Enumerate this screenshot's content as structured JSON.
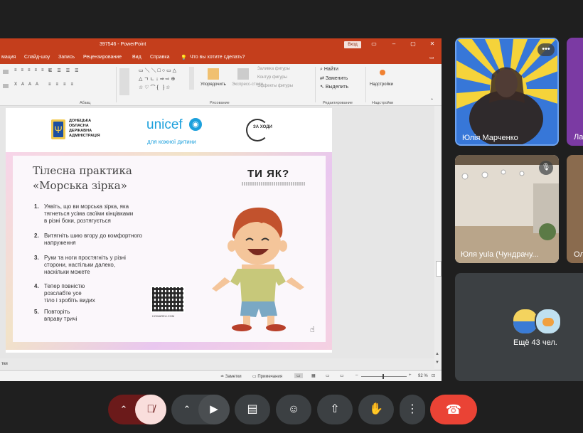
{
  "ppt": {
    "window_title": "397546  -  PowerPoint",
    "sign_in": "Вход",
    "menu": [
      "мация",
      "Слайд-шоу",
      "Запись",
      "Рецензирование",
      "Вид",
      "Справка",
      "Что вы хотите сделать?"
    ],
    "ribbon": {
      "paragraph": "Абзац",
      "drawing": "Рисование",
      "editing": "Редактирование",
      "addins": "Надстройки",
      "arrange": "Упорядочить",
      "quick_styles": "Экспресс-стили",
      "shape_fill": "Заливка фигуры",
      "shape_outline": "Контур фигуры",
      "shape_effects": "Эффекты фигуры",
      "find": "Найти",
      "replace": "Заменить",
      "select": "Выделить",
      "addins_btn": "Надстройки"
    },
    "notes_label": "тки",
    "status": {
      "notes": "Заметки",
      "comments": "Примечания",
      "zoom": "92 %"
    }
  },
  "slide": {
    "org_left": [
      "ДОНЕЦЬКА",
      "ОБЛАСНА",
      "ДЕРЖАВНА",
      "АДМІНІСТРАЦІЯ"
    ],
    "unicef": "unicef",
    "unicef_sub": "для кожної дитини",
    "right_logo": "ЗА ХОДИ",
    "title1": "Тілесна практика",
    "title2": "«Морська зірка»",
    "brand": "ТИ ЯК?",
    "steps": [
      {
        "n": "1.",
        "lines": [
          "Уявіть, що ви морська зірка, яка",
          "тягнеться усіма своїми кінцівками",
          "в різні боки, розтягується"
        ]
      },
      {
        "n": "2.",
        "lines": [
          "Витягніть шию вгору до комфортного",
          "напруження"
        ]
      },
      {
        "n": "3.",
        "lines": [
          "Руки та ноги простягніть у різні",
          "сторони, настільки далеко,",
          "наскільки можете"
        ]
      },
      {
        "n": "4.",
        "lines": [
          "Тепер повністю",
          "розслабте усе",
          "тіло і зробіть видих"
        ]
      },
      {
        "n": "5.",
        "lines": [
          "Повторіть",
          "вправу тричі"
        ]
      }
    ],
    "qr_caption": "HOWAREU.COM"
  },
  "participants": {
    "p1": "Юлія Марченко",
    "p2": "Ла",
    "p3": "Юля yula (Чундрачу...",
    "p4": "Ол",
    "more": "Ещё 43 чел."
  },
  "colors": {
    "ppt_red": "#c43e1c",
    "end_call": "#ea4335",
    "mic_off": "#f9dedc",
    "control": "#3c4043"
  }
}
